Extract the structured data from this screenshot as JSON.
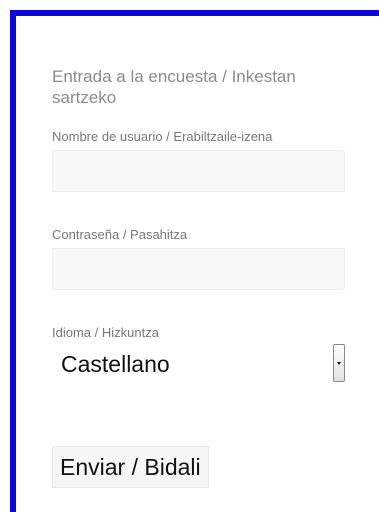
{
  "form": {
    "title": "Entrada a la encuesta / Inkestan sartzeko",
    "username": {
      "label": "Nombre de usuario / Erabiltzaile-izena",
      "value": ""
    },
    "password": {
      "label": "Contraseña / Pasahitza",
      "value": ""
    },
    "language": {
      "label": "Idioma / Hizkuntza",
      "selected": "Castellano"
    },
    "submit_label": "Enviar / Bidali"
  },
  "colors": {
    "frame_border": "#0c06d8",
    "title_text": "#8b8b8b",
    "label_text": "#777777",
    "field_background": "#f8f8f8"
  },
  "icons": {
    "select_arrow": "chevron-down-icon"
  }
}
